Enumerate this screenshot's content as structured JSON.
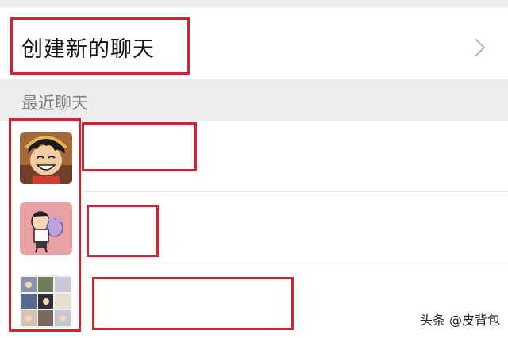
{
  "create_chat": {
    "label": "创建新的聊天"
  },
  "recent": {
    "title": "最近聊天"
  },
  "chats": [
    {
      "avatar_icon": "cartoon-boy-smiling-avatar-icon"
    },
    {
      "avatar_icon": "cartoon-kid-with-plush-avatar-icon"
    },
    {
      "avatar_icon": "group-photo-grid-avatar-icon"
    }
  ],
  "watermark": {
    "text": "头条 @皮背包"
  },
  "colors": {
    "highlight": "#d42331",
    "background": "#ededed"
  }
}
